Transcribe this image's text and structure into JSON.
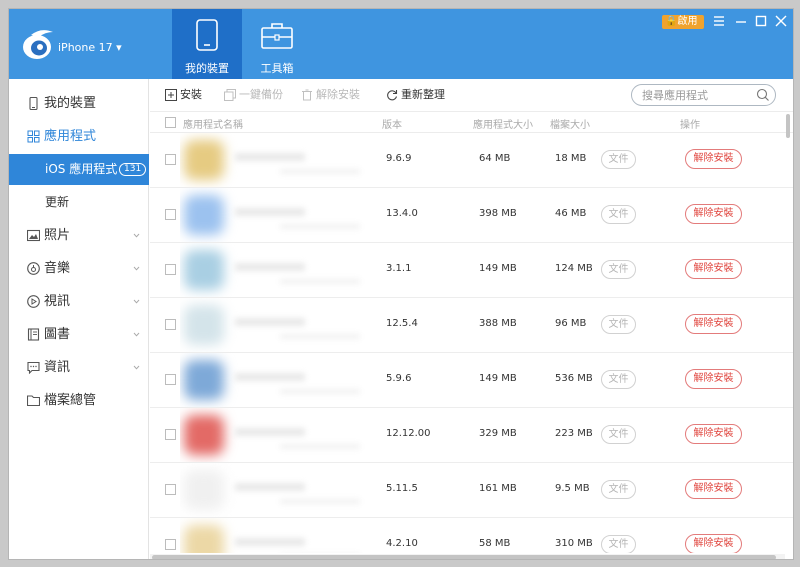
{
  "header": {
    "device_name": "iPhone 17 ▾",
    "tabs": [
      {
        "label": "我的裝置",
        "icon": "tablet-icon",
        "active": true
      },
      {
        "label": "工具箱",
        "icon": "toolbox-icon",
        "active": false
      }
    ],
    "vip_label": "啟用",
    "colors": {
      "header_bg": "#3f95e0",
      "active_tab": "#1f6fc8"
    }
  },
  "sidebar": {
    "items": [
      {
        "label": "我的裝置",
        "icon": "phone-icon"
      },
      {
        "label": "應用程式",
        "icon": "apps-grid-icon"
      },
      {
        "label": "照片",
        "icon": "photo-icon"
      },
      {
        "label": "音樂",
        "icon": "music-icon"
      },
      {
        "label": "視訊",
        "icon": "video-icon"
      },
      {
        "label": "圖書",
        "icon": "book-icon"
      },
      {
        "label": "資訊",
        "icon": "message-icon"
      },
      {
        "label": "檔案總管",
        "icon": "folder-icon"
      }
    ],
    "subitems": [
      {
        "label": "iOS 應用程式",
        "count": "131",
        "active": true
      },
      {
        "label": "更新",
        "active": false
      }
    ],
    "active_color": "#2f86d9"
  },
  "toolbar": {
    "install_label": "安裝",
    "backup_label": "一鍵備份",
    "uninstall_label": "解除安裝",
    "refresh_label": "重新整理",
    "search_placeholder": "搜尋應用程式"
  },
  "table": {
    "columns": {
      "name": "應用程式名稱",
      "version": "版本",
      "app_size": "應用程式大小",
      "doc_size": "檔案大小",
      "action": "操作"
    },
    "file_label": "文件",
    "uninstall_label": "解除安裝",
    "rows": [
      {
        "version": "9.6.9",
        "app_size": "64 MB",
        "doc_size": "18 MB",
        "icon_color": "#e6cb82"
      },
      {
        "version": "13.4.0",
        "app_size": "398 MB",
        "doc_size": "46 MB",
        "icon_color": "#9cc2ef"
      },
      {
        "version": "3.1.1",
        "app_size": "149 MB",
        "doc_size": "124 MB",
        "icon_color": "#a9cfe3"
      },
      {
        "version": "12.5.4",
        "app_size": "388 MB",
        "doc_size": "96 MB",
        "icon_color": "#d4e4ea"
      },
      {
        "version": "5.9.6",
        "app_size": "149 MB",
        "doc_size": "536 MB",
        "icon_color": "#7ea9d8"
      },
      {
        "version": "12.12.00",
        "app_size": "329 MB",
        "doc_size": "223 MB",
        "icon_color": "#e36a66"
      },
      {
        "version": "5.11.5",
        "app_size": "161 MB",
        "doc_size": "9.5 MB",
        "icon_color": "#f0f0f0"
      },
      {
        "version": "4.2.10",
        "app_size": "58 MB",
        "doc_size": "310 MB",
        "icon_color": "#ecd8a6"
      }
    ]
  }
}
